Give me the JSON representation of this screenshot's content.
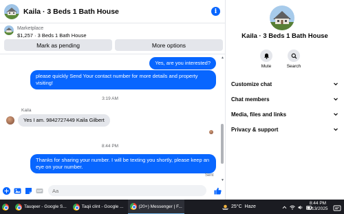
{
  "header": {
    "title": "Kaila · 3 Beds 1 Bath House",
    "info_icon": "info-icon"
  },
  "marketplace": {
    "label": "Marketplace",
    "listing": "$1,257 · 3 Beds 1 Bath House"
  },
  "actions": {
    "mark_pending": "Mark as pending",
    "more_options": "More options"
  },
  "messages": [
    {
      "dir": "out",
      "text": "Yes, are you interested?"
    },
    {
      "dir": "out",
      "text": "please quickly Send Your contact number for more details and property visiting!"
    },
    {
      "type": "time",
      "text": "3:19 AM"
    },
    {
      "type": "sender",
      "text": "Kaila"
    },
    {
      "dir": "in",
      "text": "Yes I am. 9842727449 Kaila Gilbert"
    },
    {
      "type": "time",
      "text": "8:44 PM"
    },
    {
      "dir": "out",
      "text": "Thanks for sharing your number. I will be texting you shortly, please keep an eye on your number."
    },
    {
      "type": "status",
      "text": "Sent"
    }
  ],
  "composer": {
    "placeholder": "Aa"
  },
  "info_panel": {
    "title": "Kaila · 3 Beds 1 Bath House",
    "mute_label": "Mute",
    "search_label": "Search",
    "menu": [
      "Customize chat",
      "Chat members",
      "Media, files and links",
      "Privacy & support"
    ]
  },
  "taskbar": {
    "apps": [
      "Tauqeer - Google S...",
      "Taqii clint - Google ...",
      "(20+) Messenger | F..."
    ],
    "weather": "25°C  Haze",
    "time": "8:44 PM",
    "date": "3/13/2025"
  },
  "colors": {
    "accent": "#0866ff",
    "bubble_in": "#e4e6eb",
    "taskbar": "#1b1c22"
  }
}
